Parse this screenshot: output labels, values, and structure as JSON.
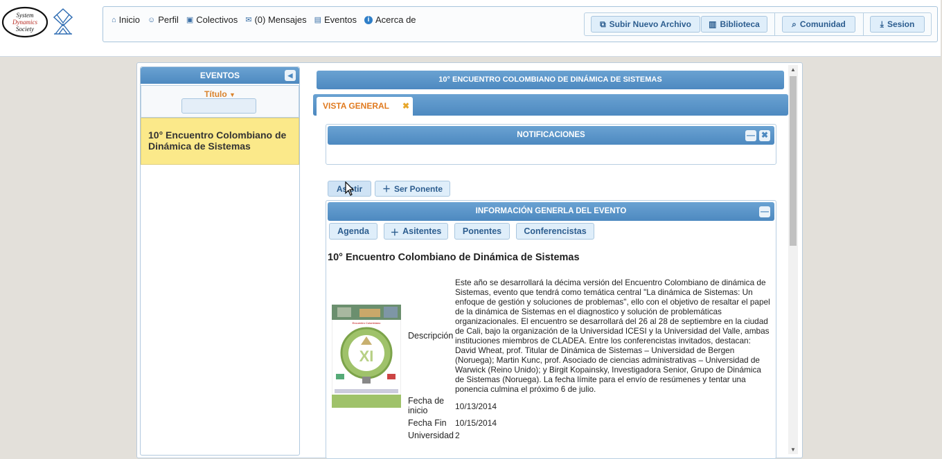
{
  "header": {
    "logo_text": [
      "System",
      "Dynamics",
      "Society"
    ],
    "nav": [
      {
        "icon": "home-icon",
        "label": "Inicio"
      },
      {
        "icon": "person-icon",
        "label": "Perfil"
      },
      {
        "icon": "group-icon",
        "label": "Colectivos"
      },
      {
        "icon": "mail-icon",
        "label": "(0) Mensajes"
      },
      {
        "icon": "calendar-icon",
        "label": "Eventos"
      },
      {
        "icon": "info-icon",
        "label": "Acerca de"
      }
    ],
    "actions": {
      "upload": "Subir Nuevo Archivo",
      "library": "Biblioteca",
      "community": "Comunidad",
      "session": "Sesion"
    }
  },
  "sidebar": {
    "title": "EVENTOS",
    "filter_label": "Título",
    "filter_value": "",
    "items": [
      {
        "label": "10° Encuentro Colombiano de Dinámica de Sistemas",
        "selected": true
      }
    ]
  },
  "main": {
    "title": "10° ENCUENTRO COLOMBIANO DE DINÁMICA DE SISTEMAS",
    "tabs": [
      {
        "label": "VISTA GENERAL",
        "active": true
      }
    ],
    "notifications": {
      "title": "NOTIFICACIONES"
    },
    "actions": {
      "attend": "Asistir",
      "speaker": "Ser Ponente"
    },
    "info": {
      "title": "INFORMACIÓN GENERLA DEL EVENTO",
      "subtabs": [
        "Agenda",
        "Asitentes",
        "Ponentes",
        "Conferencistas"
      ],
      "event_name": "10° Encuentro Colombiano de Dinámica de Sistemas",
      "description_label": "Descripción",
      "description": "Este año se desarrollará la décima versión del Encuentro Colombiano de dinámica de Sistemas, evento que tendrá como temática central \"La dinámica de Sistemas: Un enfoque de gestión y soluciones de problemas\", ello con el objetivo de resaltar el papel de la dinámica de Sistemas en el diagnostico y solución de problemáticas organizacionales. El encuentro se desarrollará del 26 al 28 de septiembre en la ciudad de Cali, bajo la organización de la Universidad ICESI y la Universidad del Valle, ambas instituciones miembros de CLADEA. Entre los conferencistas invitados, destacan: David Wheat, prof. Titular de Dinámica de Sistemas – Universidad de Bergen (Noruega); Martin Kunc, prof. Asociado de ciencias administrativas – Universidad de Warwick (Reino Unido); y Birgit Kopainsky, Investigadora Senior, Grupo de Dinámica de Sistemas (Noruega). La fecha límite para el envío de resúmenes y tentar una ponencia culmina el próximo 6 de julio.",
      "start_label": "Fecha de inicio",
      "start_date": "10/13/2014",
      "end_label": "Fecha Fin",
      "end_date": "10/15/2014",
      "university_label": "Universidad",
      "university": "2",
      "poster_text": "XI"
    }
  },
  "colors": {
    "header_blue": "#4d89c0",
    "selected_item": "#fbe98a",
    "tab_orange": "#e07a1f"
  }
}
